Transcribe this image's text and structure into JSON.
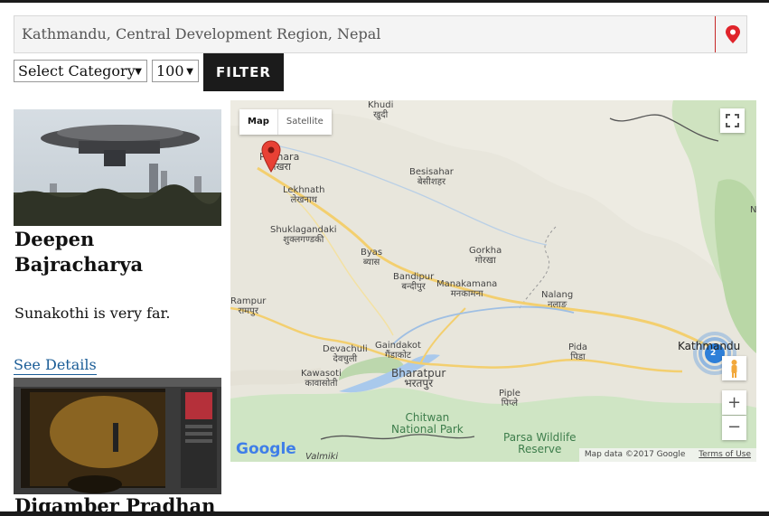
{
  "search": {
    "location_value": "Kathmandu, Central Development Region, Nepal"
  },
  "filters": {
    "category_selected": "Select Category",
    "count_selected": "100",
    "filter_label": "FILTER"
  },
  "listings": [
    {
      "name_line1": "Deepen",
      "name_line2": "Bajracharya",
      "description": "Sunakothi is very far.",
      "details_label": "See Details"
    },
    {
      "name_line1": "Digamber Pradhan"
    }
  ],
  "map": {
    "type_map_label": "Map",
    "type_satellite_label": "Satellite",
    "zoom_in_label": "+",
    "zoom_out_label": "−",
    "cluster_count": "2",
    "google_label": "Google",
    "attribution": "Map data ©2017 Google",
    "terms_label": "Terms of Use",
    "places": [
      {
        "en": "Khudi",
        "ne": "खुदी"
      },
      {
        "en": "Pokhara",
        "ne": "पोखरा"
      },
      {
        "en": "Besisahar",
        "ne": "बेसीशहर"
      },
      {
        "en": "Lekhnath",
        "ne": "लेखनाथ"
      },
      {
        "en": "Shuklagandaki",
        "ne": "शुक्लगण्डकी"
      },
      {
        "en": "Byas",
        "ne": "ब्यास"
      },
      {
        "en": "Gorkha",
        "ne": "गोरखा"
      },
      {
        "en": "Bandipur",
        "ne": "बन्दीपुर"
      },
      {
        "en": "Manakamana",
        "ne": "मनकामना"
      },
      {
        "en": "Nalang",
        "ne": "नलाङ"
      },
      {
        "en": "Rampur",
        "ne": "रामपुर"
      },
      {
        "en": "Devachuli",
        "ne": "देवचुली"
      },
      {
        "en": "Gaindakot",
        "ne": "गैंडाकोट"
      },
      {
        "en": "Pida",
        "ne": "पिडा"
      },
      {
        "en": "Kathmandu",
        "ne": ""
      },
      {
        "en": "Kawasoti",
        "ne": "कावासोती"
      },
      {
        "en": "Bharatpur",
        "ne": "भरतपुर"
      },
      {
        "en": "Piple",
        "ne": "पिप्ले"
      },
      {
        "en": "Valmiki",
        "ne": ""
      }
    ],
    "parks": [
      {
        "line1": "Chitwan",
        "line2": "National Park"
      },
      {
        "line1": "Parsa Wildlife",
        "line2": "Reserve"
      }
    ],
    "edge_label": "N"
  }
}
